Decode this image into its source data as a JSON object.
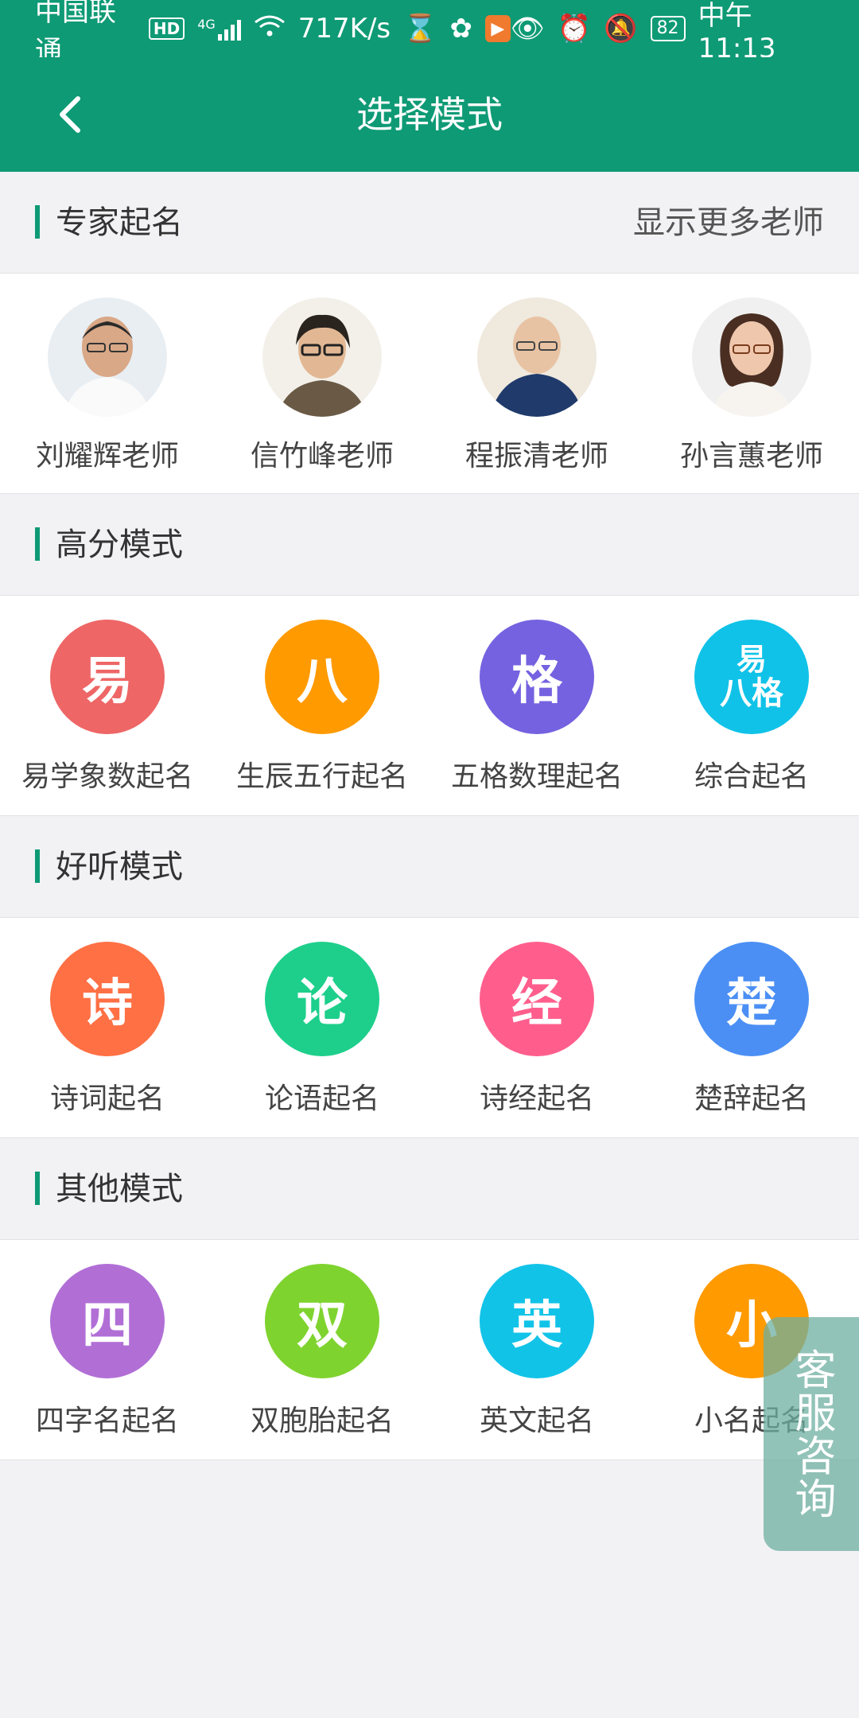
{
  "status_bar": {
    "carrier": "中国联通",
    "hd": "HD",
    "net": "4G",
    "speed": "717K/s",
    "app_badge": "▶",
    "battery": "82",
    "time": "中午11:13"
  },
  "header": {
    "title": "选择模式"
  },
  "experts": {
    "title": "专家起名",
    "more": "显示更多老师",
    "items": [
      {
        "label": "刘耀辉老师"
      },
      {
        "label": "信竹峰老师"
      },
      {
        "label": "程振清老师"
      },
      {
        "label": "孙言蕙老师"
      }
    ]
  },
  "high_score": {
    "title": "高分模式",
    "items": [
      {
        "glyph": "易",
        "label": "易学象数起名",
        "color": "#ee6666"
      },
      {
        "glyph": "八",
        "label": "生辰五行起名",
        "color": "#ff9a00"
      },
      {
        "glyph": "格",
        "label": "五格数理起名",
        "color": "#7462e0"
      },
      {
        "glyph_top": "易",
        "glyph_bottom": "八格",
        "label": "综合起名",
        "color": "#10c2e8"
      }
    ]
  },
  "pleasant": {
    "title": "好听模式",
    "items": [
      {
        "glyph": "诗",
        "label": "诗词起名",
        "color": "#ff7045"
      },
      {
        "glyph": "论",
        "label": "论语起名",
        "color": "#1ecf8c"
      },
      {
        "glyph": "经",
        "label": "诗经起名",
        "color": "#ff5e8d"
      },
      {
        "glyph": "楚",
        "label": "楚辞起名",
        "color": "#4b8ff5"
      }
    ]
  },
  "other": {
    "title": "其他模式",
    "items": [
      {
        "glyph": "四",
        "label": "四字名起名",
        "color": "#b16fd6"
      },
      {
        "glyph": "双",
        "label": "双胞胎起名",
        "color": "#7fd32f"
      },
      {
        "glyph": "英",
        "label": "英文起名",
        "color": "#12c3e8"
      },
      {
        "glyph": "小",
        "label": "小名起名",
        "color": "#ff9a00"
      }
    ]
  },
  "service": {
    "text": "客服咨询"
  }
}
